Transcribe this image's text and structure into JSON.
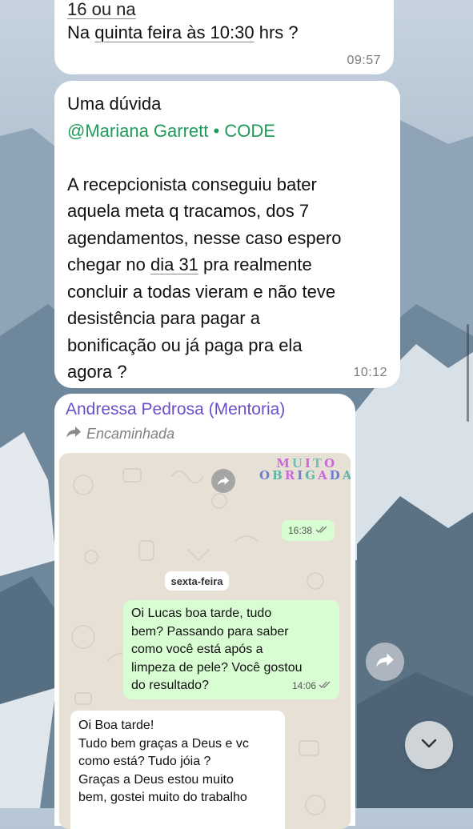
{
  "messages": [
    {
      "partial_top": "16 ou na",
      "text_prefix": "Na ",
      "text_link": "quinta feira às 10:30",
      "text_suffix": " hrs ?",
      "time": "09:57"
    },
    {
      "line_question": "Uma dúvida",
      "mention": "@Mariana Garrett • CODE",
      "body_1": "A recepcionista conseguiu bater",
      "body_2": "aquela meta q tracamos, dos 7",
      "body_3": "agendamentos, nesse caso espero",
      "body_4_pre": "chegar no ",
      "body_4_link": "dia 31",
      "body_4_post": " pra realmente",
      "body_5": "concluir a todas vieram e não teve",
      "body_6": "desistência para pagar a",
      "body_7": "bonificação ou já paga pra ela",
      "body_8": "agora ?",
      "time": "10:12"
    }
  ],
  "forwarded": {
    "sender": "Andressa Pedrosa (Mentoria)",
    "forwarded_label": "Encaminhada",
    "screenshot": {
      "sticker_line1": "MUITO",
      "sticker_line2": "OBRIGADA",
      "sticker_time": "16:38",
      "day_label": "sexta-feira",
      "outgoing": {
        "line1": "Oi Lucas boa tarde, tudo",
        "line2": "bem? Passando para saber",
        "line3": "como você está após a",
        "line4": "limpeza de pele? Você gostou",
        "line5": "do resultado?",
        "time": "14:06"
      },
      "incoming": {
        "line1": "Oi Boa tarde!",
        "line2": "Tudo bem graças a Deus e vc",
        "line3": "como está? Tudo jóia ?",
        "line4": "Graças a Deus estou muito",
        "line5": "bem, gostei muito do trabalho"
      }
    }
  },
  "colors": {
    "mention": "#1f9b59",
    "sender": "#6a4fc8",
    "outgoing_bubble": "#d9fdd3"
  },
  "icons": {
    "forward": "forward-arrow-icon",
    "scroll_down": "chevron-down-icon",
    "read_receipt": "double-check-icon"
  }
}
